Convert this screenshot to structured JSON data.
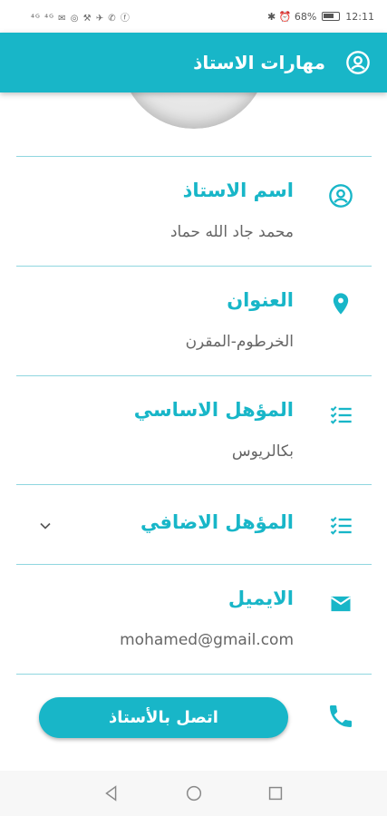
{
  "status_bar": {
    "left_icons": "⁴ᴳ ⁴ᴳ ✉ ◎ ⚒ ✈ ✆ ⓕ",
    "right_text": "✱ ⏰ 68% ",
    "time": "12:11"
  },
  "app_bar": {
    "title": "مهارات الاستاذ",
    "icon": "account-circle-icon",
    "color": "#18b6c8"
  },
  "fields": [
    {
      "label": "اسم الاستاذ",
      "value": "محمد جاد الله حماد",
      "icon": "person-circle-icon"
    },
    {
      "label": "العنوان",
      "value": "الخرطوم-المقرن",
      "icon": "location-pin-icon"
    },
    {
      "label": "المؤهل الاساسي",
      "value": "بكالريوس",
      "icon": "checklist-icon"
    },
    {
      "label": "المؤهل الاضافي",
      "value": "",
      "icon": "checklist-icon",
      "expand_icon": "chevron-down-icon"
    },
    {
      "label": "الايميل",
      "value": "mohamed@gmail.com",
      "icon": "mail-icon"
    }
  ],
  "contact": {
    "button_label": "اتصل بالأستاذ",
    "icon": "phone-icon"
  },
  "nav_bar": {
    "back_icon": "back-triangle-icon",
    "home_icon": "home-circle-icon",
    "recents_icon": "recents-square-icon"
  }
}
